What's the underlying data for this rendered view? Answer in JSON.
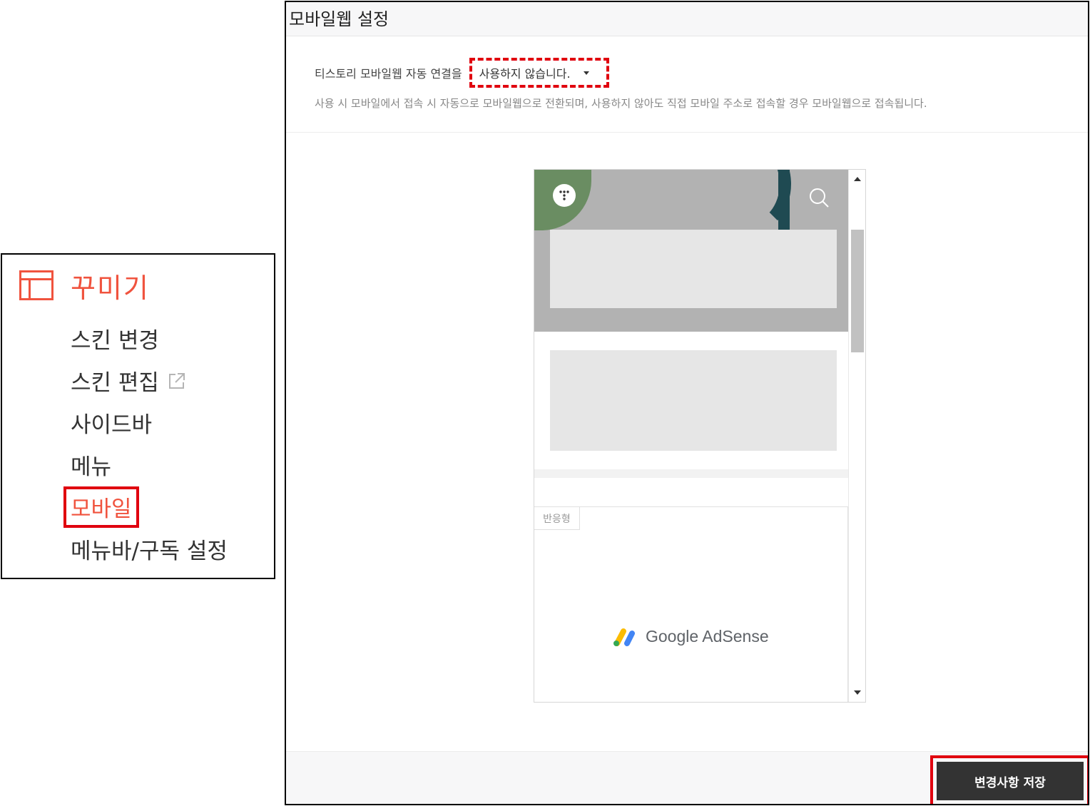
{
  "sidebar": {
    "title": "꾸미기",
    "items": [
      {
        "label": "스킨 변경"
      },
      {
        "label": "스킨 편집"
      },
      {
        "label": "사이드바"
      },
      {
        "label": "메뉴"
      },
      {
        "label": "모바일"
      },
      {
        "label": "메뉴바/구독 설정"
      }
    ],
    "active_item": "모바일",
    "accent_color": "#f0533e"
  },
  "settings": {
    "title": "모바일웹 설정",
    "auto_link_label": "티스토리 모바일웹 자동 연결을",
    "auto_link_value": "사용하지 않습니다.",
    "description": "사용 시 모바일에서 접속 시 자동으로 모바일웹으로 전환되며, 사용하지 않아도 직접 모바일 주소로 접속할 경우 모바일웹으로 접속됩니다."
  },
  "preview": {
    "ad_tag": "반응형",
    "ad_brand": "Google AdSense"
  },
  "footer": {
    "save_label": "변경사항 저장"
  },
  "highlight_color": "#e0000e"
}
